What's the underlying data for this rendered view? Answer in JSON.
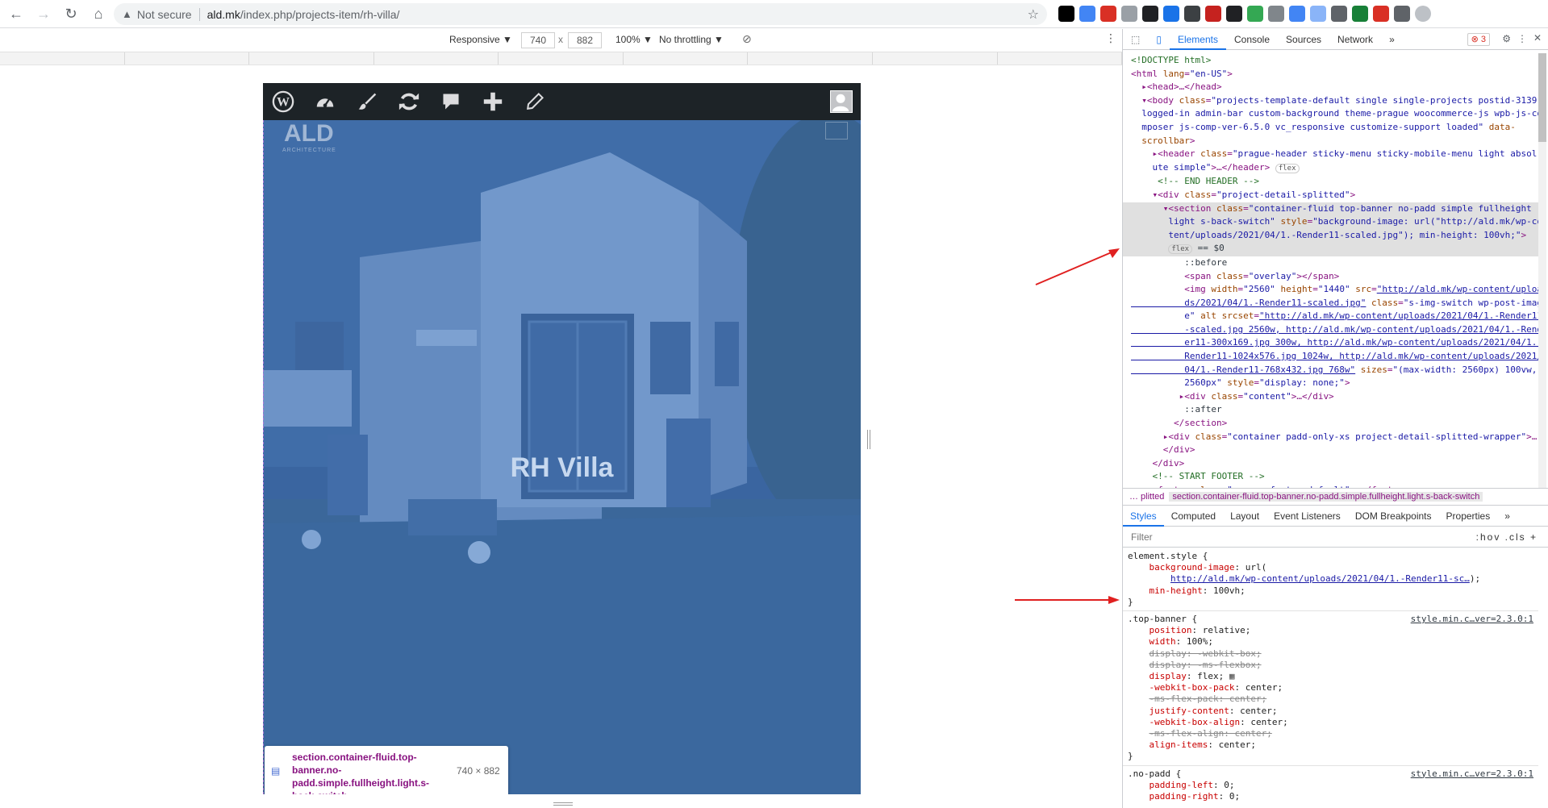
{
  "browser": {
    "not_secure": "Not secure",
    "url_host": "ald.mk",
    "url_path": "/index.php/projects-item/rh-villa/",
    "extensions": [
      {
        "name": "flag-de-icon",
        "color": "#000000"
      },
      {
        "name": "translate-icon",
        "color": "#4285f4"
      },
      {
        "name": "ext-red-icon",
        "color": "#d93025"
      },
      {
        "name": "ext-gray-icon",
        "color": "#9aa0a6"
      },
      {
        "name": "eyedropper-icon",
        "color": "#202124"
      },
      {
        "name": "ext-blue-icon",
        "color": "#1a73e8"
      },
      {
        "name": "ext-dark-icon",
        "color": "#3c4043"
      },
      {
        "name": "ext-red2-icon",
        "color": "#c5221f"
      },
      {
        "name": "ext-fx-icon",
        "color": "#202124"
      },
      {
        "name": "ext-green-icon",
        "color": "#34a853"
      },
      {
        "name": "ext-img-icon",
        "color": "#80868b"
      },
      {
        "name": "ext-bird-icon",
        "color": "#4285f4"
      },
      {
        "name": "ext-lightblue-icon",
        "color": "#8ab4f8"
      },
      {
        "name": "ext-moon-icon",
        "color": "#5f6368"
      },
      {
        "name": "ext-shield-icon",
        "color": "#188038"
      },
      {
        "name": "ext-a-icon",
        "color": "#d93025"
      },
      {
        "name": "puzzle-icon",
        "color": "#5f6368"
      },
      {
        "name": "profile-icon",
        "color": "#bdc1c6"
      }
    ]
  },
  "device_toolbar": {
    "mode": "Responsive ▼",
    "width": "740",
    "times": "x",
    "height": "882",
    "zoom": "100% ▼",
    "throttling": "No throttling ▼"
  },
  "page": {
    "logo": "ALD",
    "logo_sub": "ARCHITECTURE",
    "title": "RH Villa"
  },
  "tooltip": {
    "selector": "section.container-fluid.top-banner.no-padd.simple.fullheight.light.s-back-switch",
    "size": "740 × 882"
  },
  "devtools": {
    "tabs": [
      "Elements",
      "Console",
      "Sources",
      "Network",
      "»"
    ],
    "error_count": "3",
    "crumbs_left": "…  plitted",
    "crumbs_selected": "section.container-fluid.top-banner.no-padd.simple.fullheight.light.s-back-switch",
    "sub_tabs": [
      "Styles",
      "Computed",
      "Layout",
      "Event Listeners",
      "DOM Breakpoints",
      "Properties",
      "»"
    ],
    "filter_placeholder": "Filter",
    "filter_tools": ":hov  .cls  +",
    "style_src": "style.min.c…ver=2.3.0:1"
  },
  "colors": {
    "accent": "#1a73e8",
    "adminbar": "#1d2327",
    "arrow": "#e02020"
  }
}
